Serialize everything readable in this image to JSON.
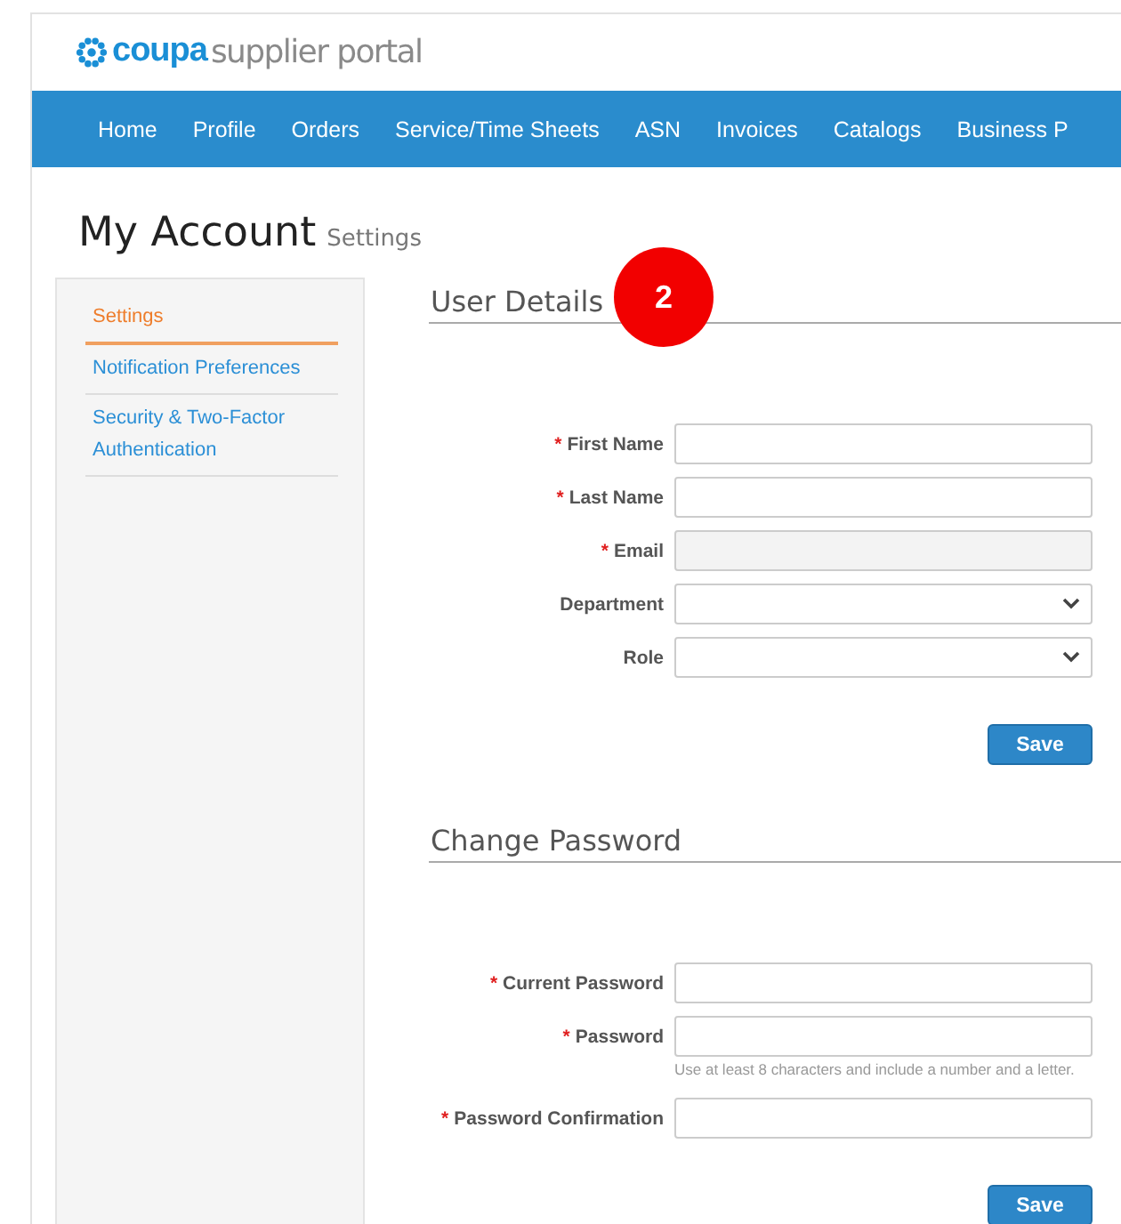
{
  "logo": {
    "brand": "coupa",
    "product": "supplier portal"
  },
  "nav": [
    {
      "label": "Home"
    },
    {
      "label": "Profile"
    },
    {
      "label": "Orders"
    },
    {
      "label": "Service/Time Sheets"
    },
    {
      "label": "ASN"
    },
    {
      "label": "Invoices"
    },
    {
      "label": "Catalogs"
    },
    {
      "label": "Business P"
    }
  ],
  "page_title": {
    "title": "My Account",
    "subtitle": "Settings"
  },
  "sidebar": {
    "items": [
      {
        "label": "Settings",
        "selected": true
      },
      {
        "label": "Notification Preferences",
        "selected": false
      },
      {
        "label": "Security & Two-Factor Authentication",
        "selected": false
      }
    ]
  },
  "annotation_badge": "2",
  "sections": [
    {
      "title": "User Details",
      "fields": [
        {
          "label": "First Name",
          "kind": "text",
          "marker": "*"
        },
        {
          "label": "Last Name",
          "kind": "text",
          "marker": "*"
        },
        {
          "label": "Email",
          "kind": "readonly",
          "marker": "*"
        },
        {
          "label": "Department",
          "kind": "select"
        },
        {
          "label": "Role",
          "kind": "select"
        }
      ],
      "button": "Save"
    },
    {
      "title": "Change Password",
      "fields": [
        {
          "label": "Current Password",
          "kind": "text",
          "marker": "*"
        },
        {
          "label": "Password",
          "kind": "text",
          "marker": "*",
          "hint": "Use at least 8 characters and include a number and a letter."
        },
        {
          "label": "Password Confirmation",
          "kind": "text",
          "marker": "*"
        }
      ],
      "button": "Save"
    }
  ]
}
